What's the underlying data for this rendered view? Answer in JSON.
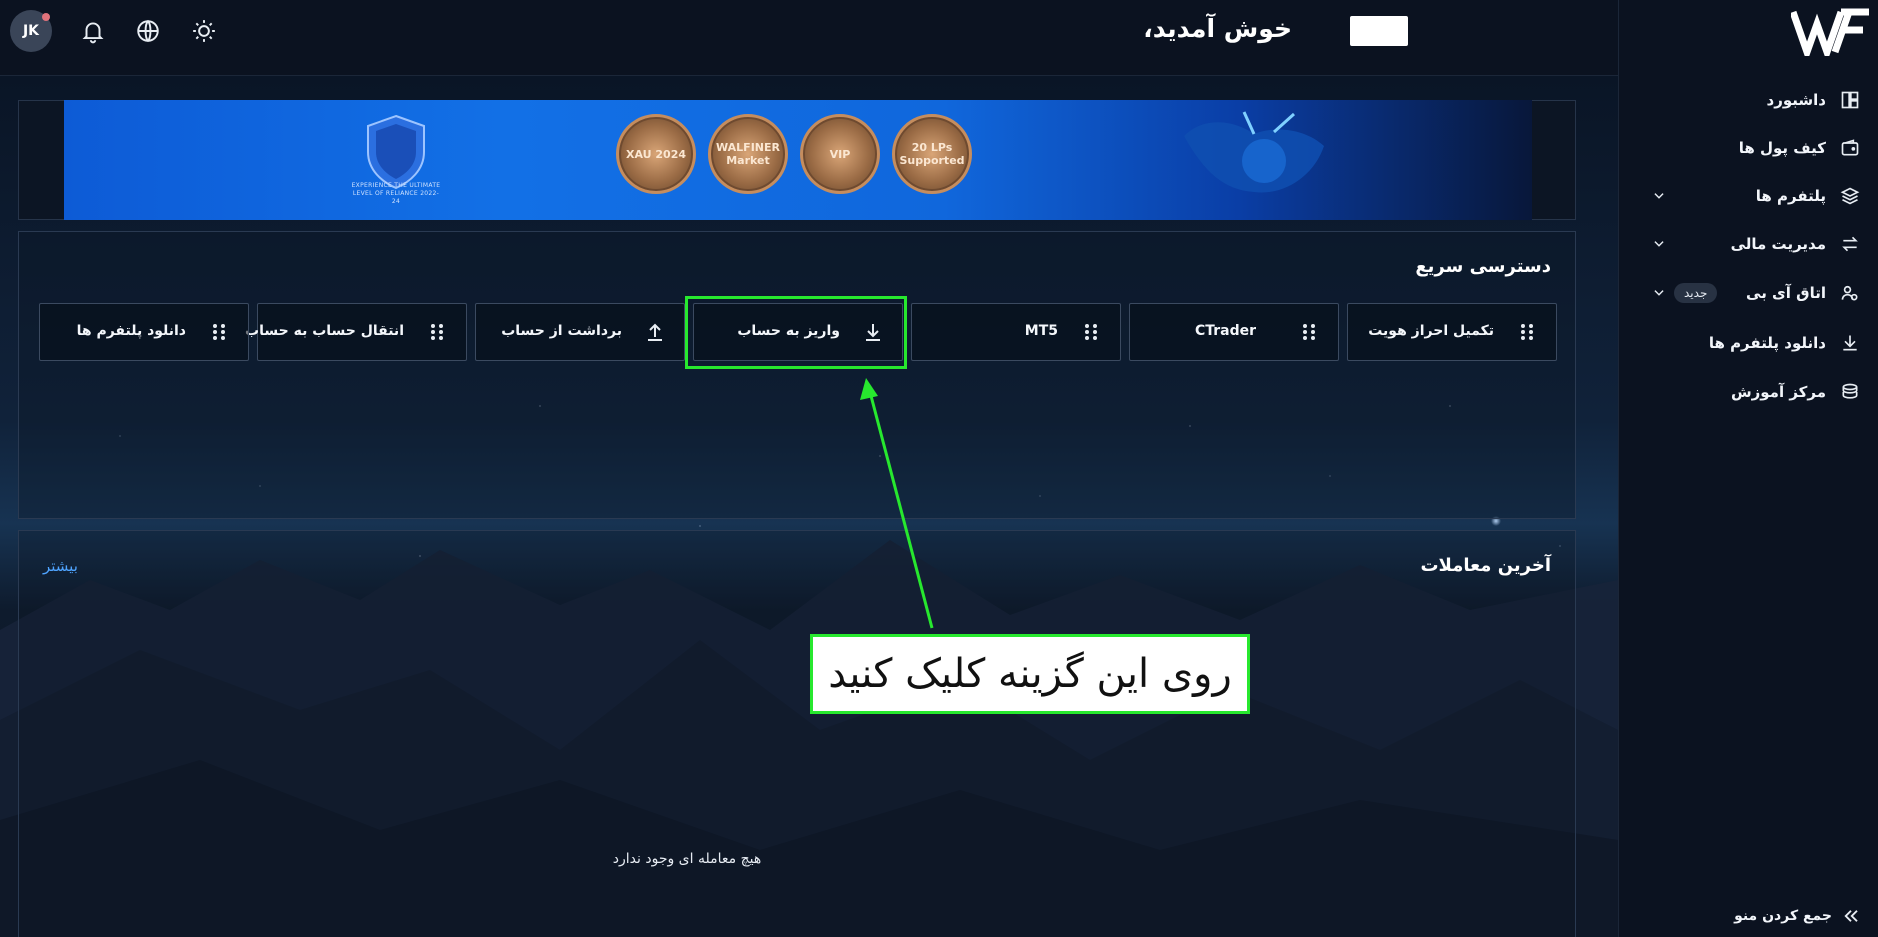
{
  "header": {
    "avatar_initials": "JK",
    "welcome_text": "خوش آمدید،"
  },
  "sidebar": {
    "items": [
      {
        "label": "داشبورد",
        "icon": "dashboard-icon"
      },
      {
        "label": "کیف پول ها",
        "icon": "wallet-icon"
      },
      {
        "label": "پلتفرم ها",
        "icon": "layers-icon"
      },
      {
        "label": "مدیریت مالی",
        "icon": "transfer-arrows-icon"
      },
      {
        "label": "اتاق آی بی",
        "icon": "users-icon",
        "badge": "جدید"
      },
      {
        "label": "دانلود پلتفرم ها",
        "icon": "download-icon"
      },
      {
        "label": "مرکز آموزش",
        "icon": "stack-icon"
      }
    ],
    "collapse_label": "جمع کردن منو"
  },
  "banner": {
    "shield_caption": "EXPERIENCE THE ULTIMATE LEVEL OF RELIANCE 2022-24",
    "medals": [
      "XAU 2024",
      "WALFINER Market",
      "VIP",
      "20 LPs Supported"
    ]
  },
  "quick_access": {
    "title": "دسترسی سریع",
    "buttons": [
      {
        "label": "تکمیل احراز هویت",
        "icon": "grip-icon"
      },
      {
        "label": "CTrader",
        "icon": "grip-icon"
      },
      {
        "label": "MT5",
        "icon": "grip-icon"
      },
      {
        "label": "واریز به حساب",
        "icon": "download-icon"
      },
      {
        "label": "برداشت از حساب",
        "icon": "upload-icon"
      },
      {
        "label": "انتقال حساب به حساب",
        "icon": "grip-icon"
      },
      {
        "label": "دانلود پلتفرم ها",
        "icon": "grip-icon"
      }
    ]
  },
  "recent_trades": {
    "title": "آخرین معاملات",
    "more_label": "بیشتر",
    "empty_text": "هیچ معامله ای وجود ندارد"
  },
  "annotation": {
    "note": "روی این گزینه کلیک کنید",
    "color": "#27e82e"
  },
  "colors": {
    "background": "#0b1220",
    "accent_link": "#4fa4ff",
    "badge_bg": "#283243"
  }
}
